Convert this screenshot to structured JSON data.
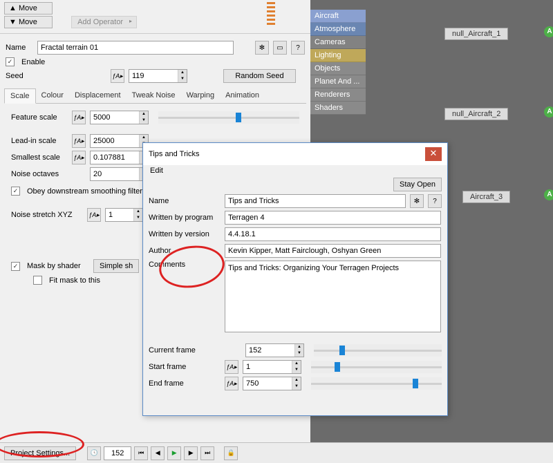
{
  "toolbar": {
    "move1": "▲  Move",
    "move2": "▼  Move",
    "addop": "Add Operator"
  },
  "node": {
    "name_lbl": "Name",
    "name_val": "Fractal terrain 01",
    "enable_lbl": "Enable",
    "seed_lbl": "Seed",
    "seed_val": "119",
    "random_seed": "Random Seed",
    "tabs": [
      "Scale",
      "Colour",
      "Displacement",
      "Tweak Noise",
      "Warping",
      "Animation"
    ],
    "feature_lbl": "Feature scale",
    "feature_val": "5000",
    "leadin_lbl": "Lead-in scale",
    "leadin_val": "25000",
    "smallest_lbl": "Smallest scale",
    "smallest_val": "0.107881",
    "octaves_lbl": "Noise octaves",
    "octaves_val": "20",
    "obey_lbl": "Obey downstream smoothing filter",
    "stretch_lbl": "Noise stretch XYZ",
    "stretch_val": "1",
    "mask_lbl": "Mask by shader",
    "mask_btn": "Simple sh",
    "fit_lbl": "Fit mask to this"
  },
  "cats": [
    {
      "t": "Aircraft",
      "c": "#8aa0d0"
    },
    {
      "t": "Atmosphere",
      "c": "#6a86b2"
    },
    {
      "t": "Cameras",
      "c": "#828282"
    },
    {
      "t": "Lighting",
      "c": "#bfa85a"
    },
    {
      "t": "Objects",
      "c": "#8a8a8a"
    },
    {
      "t": "Planet And ...",
      "c": "#8a8a8a"
    },
    {
      "t": "Renderers",
      "c": "#8a8a8a"
    },
    {
      "t": "Shaders",
      "c": "#8a8a8a"
    }
  ],
  "nodes": {
    "n1": "null_Aircraft_1",
    "n2": "null_Aircraft_2",
    "n3": "Aircraft_3"
  },
  "dlg": {
    "title": "Tips and Tricks",
    "edit": "Edit",
    "stay": "Stay Open",
    "name_lbl": "Name",
    "name_val": "Tips and Tricks",
    "prog_lbl": "Written by program",
    "prog_val": "Terragen 4",
    "ver_lbl": "Written by version",
    "ver_val": "4.4.18.1",
    "auth_lbl": "Author",
    "auth_val": "Kevin Kipper, Matt Fairclough, Oshyan Green",
    "comm_lbl": "Comments",
    "comm_val": "Tips and Tricks: Organizing Your Terragen Projects",
    "cframe_lbl": "Current frame",
    "cframe_val": "152",
    "sframe_lbl": "Start frame",
    "sframe_val": "1",
    "eframe_lbl": "End frame",
    "eframe_val": "750"
  },
  "bottom": {
    "proj": "Project Settings...",
    "frame": "152"
  }
}
